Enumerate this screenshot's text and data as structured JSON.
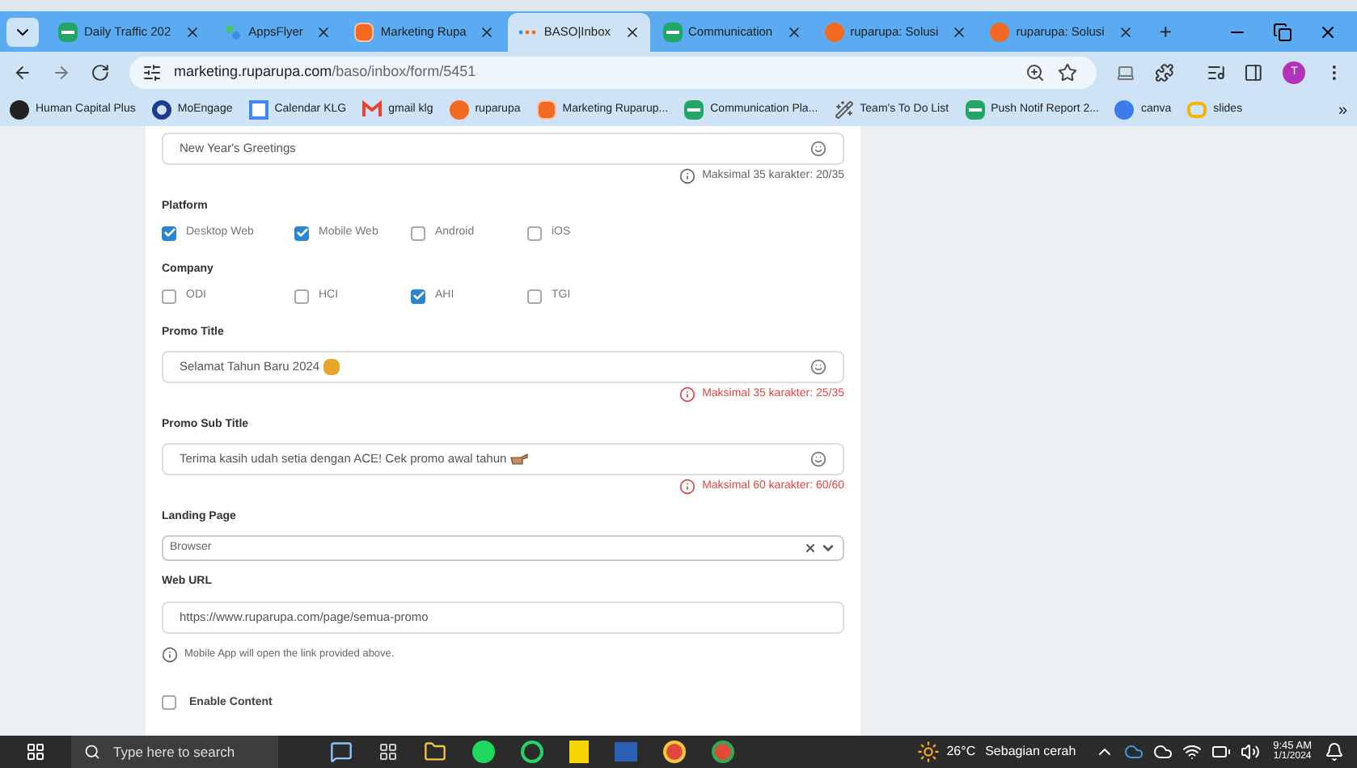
{
  "tabs": [
    {
      "title": "Daily Traffic 202",
      "selected": false
    },
    {
      "title": "AppsFlyer",
      "selected": false
    },
    {
      "title": "Marketing Rupa",
      "selected": false
    },
    {
      "title": "BASO|Inbox",
      "selected": true
    },
    {
      "title": "Communication",
      "selected": false
    },
    {
      "title": "ruparupa: Solusi",
      "selected": false
    },
    {
      "title": "ruparupa: Solusi",
      "selected": false
    }
  ],
  "new_tab": "+",
  "address": {
    "host": "marketing.ruparupa.com",
    "path": "/baso/inbox/form/5451"
  },
  "profile": "T",
  "bookmarks": [
    {
      "title": "Human Capital Plus"
    },
    {
      "title": "MoEngage"
    },
    {
      "title": "Calendar KLG"
    },
    {
      "title": "gmail klg"
    },
    {
      "title": "ruparupa"
    },
    {
      "title": "Marketing Ruparup..."
    },
    {
      "title": "Communication Pla..."
    },
    {
      "title": "Team's To Do List"
    },
    {
      "title": "Push Notif Report 2..."
    },
    {
      "title": "canva"
    },
    {
      "title": "slides"
    }
  ],
  "bookmarks_more": "»",
  "form": [
    {
      "kind": "text",
      "value": "New Year's Greetings",
      "hint": "Maksimal 35 karakter: 20/35",
      "error": false
    },
    {
      "kind": "checks",
      "label": "Platform",
      "options": [
        {
          "label": "Desktop Web",
          "checked": true
        },
        {
          "label": "Mobile Web",
          "checked": true
        },
        {
          "label": "Android",
          "checked": false
        },
        {
          "label": "iOS",
          "checked": false
        }
      ]
    },
    {
      "kind": "checks",
      "label": "Company",
      "options": [
        {
          "label": "ODI",
          "checked": false
        },
        {
          "label": "HCI",
          "checked": false
        },
        {
          "label": "AHI",
          "checked": true
        },
        {
          "label": "TGI",
          "checked": false
        }
      ]
    },
    {
      "kind": "text",
      "label": "Promo Title",
      "value": "Selamat Tahun Baru 2024",
      "hint": "Maksimal 35 karakter: 25/35",
      "error": true
    },
    {
      "kind": "text",
      "label": "Promo Sub Title",
      "value": "Terima kasih udah setia dengan ACE! Cek promo awal tahun",
      "hint": "Maksimal 60 karakter: 60/60",
      "error": true
    },
    {
      "kind": "select",
      "label": "Landing Page",
      "value": "Browser"
    },
    {
      "kind": "url",
      "label": "Web URL",
      "value": "https://www.ruparupa.com/page/semua-promo",
      "note": "Mobile App will open the link provided above."
    },
    {
      "kind": "check",
      "label": "Enable Content",
      "checked": false
    }
  ],
  "taskbar": {
    "search_placeholder": "Type here to search",
    "weather": "26°C",
    "weather_text": "Sebagian cerah",
    "time": "9:45 AM",
    "date": "1/1/2024"
  }
}
